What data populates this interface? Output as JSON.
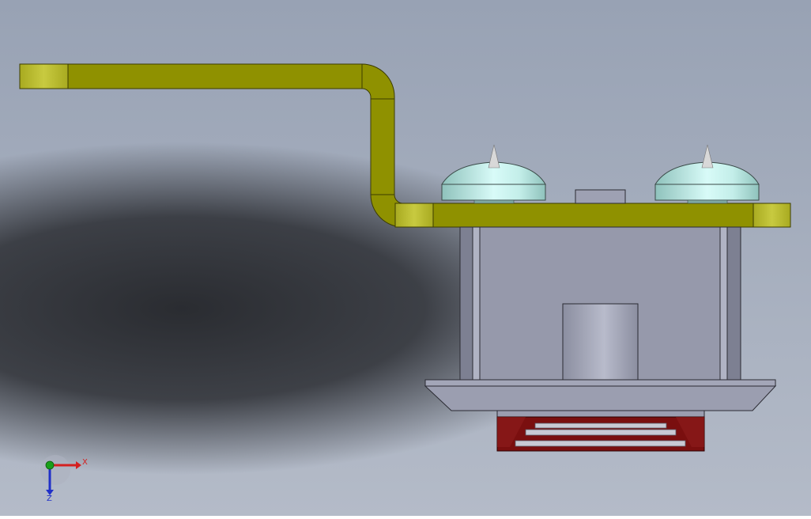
{
  "viewport": {
    "background_top": "#98a2b4",
    "background_shadow": "#2a2c31",
    "background_bottom": "#b4bbc8"
  },
  "colors": {
    "strip_fill": "#8f9100",
    "strip_light": "#b8ba2a",
    "strip_edge": "#3d3d00",
    "housing_fill": "#9699ab",
    "housing_dark": "#7d8092",
    "dome_fill": "#a9d6d0",
    "dome_highlight": "#d8fbf8",
    "base_fill": "#7a0f0f",
    "axis_x": "#d42020",
    "axis_y": "#19a019",
    "axis_z": "#2030c8"
  },
  "triad": {
    "x_label": "X",
    "z_label": "Z",
    "icon": "coordinate-triad-icon"
  }
}
